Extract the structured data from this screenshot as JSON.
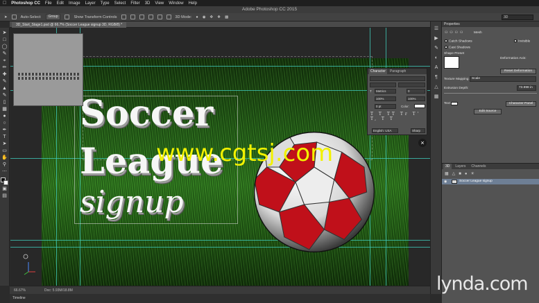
{
  "menubar": {
    "app_name": "Photoshop CC",
    "items": [
      "File",
      "Edit",
      "Image",
      "Layer",
      "Type",
      "Select",
      "Filter",
      "3D",
      "View",
      "Window",
      "Help"
    ]
  },
  "window_title": "Adobe Photoshop CC 2015",
  "options_bar": {
    "auto_select_label": "Auto-Select:",
    "auto_select_value": "Group",
    "show_transform_label": "Show Transform Controls",
    "mode_label": "3D Mode:",
    "workspace_value": "3D"
  },
  "document_tab": "3D_Start_Stage1.psd @ 66.7% (Soccer League signup 3D, RGB/8) *",
  "canvas": {
    "line1": "Soccer",
    "line2": "League",
    "line3": "signup",
    "watermark": "www.cgtsj.com",
    "close_glyph": "×"
  },
  "character_panel": {
    "tab_character": "Character",
    "tab_paragraph": "Paragraph",
    "font_size": "T",
    "metrics": "Metrics",
    "value_zero": "0",
    "scale_v": "100%",
    "scale_h": "100%",
    "baseline": "0 pt",
    "color_label": "Color:",
    "glyphs": "T T TT Tr T' T, T T",
    "language": "English: USA",
    "antialias": "Sharp"
  },
  "properties_panel": {
    "title": "Properties",
    "mesh_label": "Mesh",
    "catch_shadows": "Catch Shadows",
    "invisible": "Invisible",
    "cast_shadows": "Cast Shadows",
    "shape_preset": "Shape Preset",
    "deformation_axis": "Deformation Axis:",
    "reset_deformation": "Reset Deformation",
    "texture_mapping": "Texture Mapping:",
    "texture_value": "Scale",
    "extrusion_depth": "Extrusion Depth:",
    "extrusion_value": "73.998 in",
    "text_label": "Text:",
    "character_panel_btn": "Character Panel",
    "edit_source_btn": "Edit Source"
  },
  "layers_panel": {
    "tab_3d": "3D",
    "tab_layers": "Layers",
    "tab_channels": "Channels",
    "row_name": "Soccer League signup"
  },
  "status": {
    "zoom": "66.67%",
    "doc": "Doc: 5.93M/18.8M"
  },
  "timeline_label": "Timeline",
  "brand": "lynda.com",
  "colors": {
    "guide": "#3ec8b8",
    "watermark": "#f2f200",
    "panel": "#535353",
    "ball_red": "#c0101a"
  }
}
